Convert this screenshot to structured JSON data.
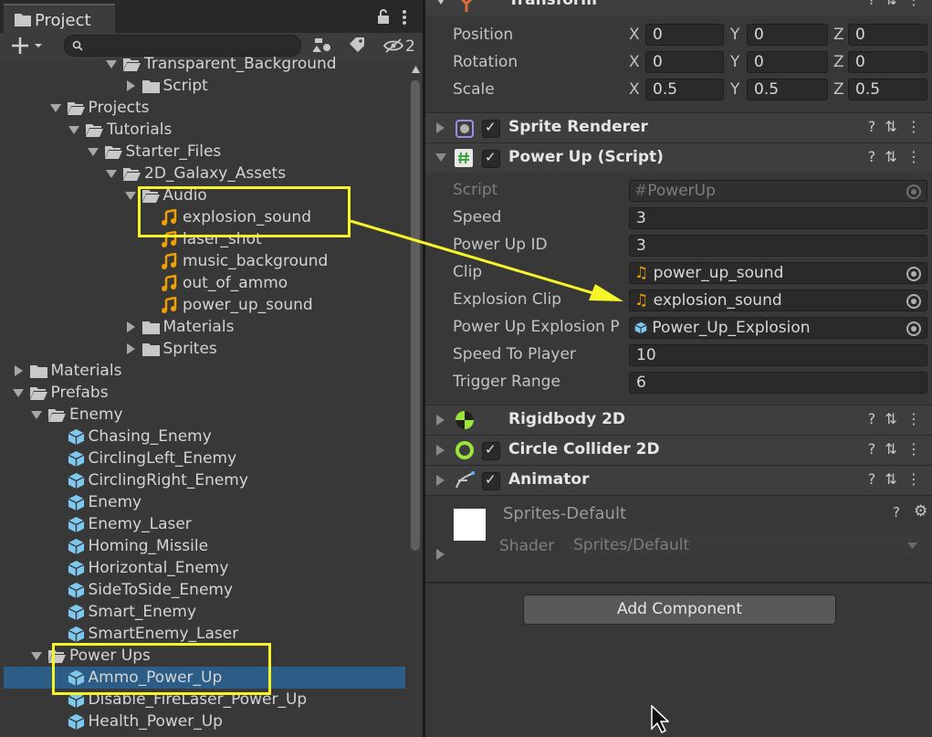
{
  "project_panel": {
    "tab_title": "Project",
    "hidden_count": "2",
    "tree": [
      {
        "label": "Transparent_Background",
        "type": "folder-open",
        "depth": 6
      },
      {
        "label": "Script",
        "type": "folder-closed",
        "depth": 7
      },
      {
        "label": "Projects",
        "type": "folder-open",
        "depth": 3
      },
      {
        "label": "Tutorials",
        "type": "folder-open",
        "depth": 4
      },
      {
        "label": "Starter_Files",
        "type": "folder-open",
        "depth": 5
      },
      {
        "label": "2D_Galaxy_Assets",
        "type": "folder-open",
        "depth": 6
      },
      {
        "label": "Audio",
        "type": "folder-open",
        "depth": 7
      },
      {
        "label": "explosion_sound",
        "type": "audio",
        "depth": 8
      },
      {
        "label": "laser_shot",
        "type": "audio",
        "depth": 8
      },
      {
        "label": "music_background",
        "type": "audio",
        "depth": 8
      },
      {
        "label": "out_of_ammo",
        "type": "audio",
        "depth": 8
      },
      {
        "label": "power_up_sound",
        "type": "audio",
        "depth": 8
      },
      {
        "label": "Materials",
        "type": "folder-closed",
        "depth": 7
      },
      {
        "label": "Sprites",
        "type": "folder-closed",
        "depth": 7
      },
      {
        "label": "Materials",
        "type": "folder-closed",
        "depth": 1
      },
      {
        "label": "Prefabs",
        "type": "folder-open",
        "depth": 1
      },
      {
        "label": "Enemy",
        "type": "folder-open",
        "depth": 2
      },
      {
        "label": "Chasing_Enemy",
        "type": "prefab",
        "depth": 3
      },
      {
        "label": "CirclingLeft_Enemy",
        "type": "prefab",
        "depth": 3
      },
      {
        "label": "CirclingRight_Enemy",
        "type": "prefab",
        "depth": 3
      },
      {
        "label": "Enemy",
        "type": "prefab",
        "depth": 3
      },
      {
        "label": "Enemy_Laser",
        "type": "prefab",
        "depth": 3
      },
      {
        "label": "Homing_Missile",
        "type": "prefab",
        "depth": 3
      },
      {
        "label": "Horizontal_Enemy",
        "type": "prefab",
        "depth": 3
      },
      {
        "label": "SideToSide_Enemy",
        "type": "prefab",
        "depth": 3
      },
      {
        "label": "Smart_Enemy",
        "type": "prefab",
        "depth": 3
      },
      {
        "label": "SmartEnemy_Laser",
        "type": "prefab",
        "depth": 3
      },
      {
        "label": "Power Ups",
        "type": "folder-open",
        "depth": 2
      },
      {
        "label": "Ammo_Power_Up",
        "type": "prefab",
        "depth": 3,
        "selected": true
      },
      {
        "label": "Disable_FireLaser_Power_Up",
        "type": "prefab",
        "depth": 3
      },
      {
        "label": "Health_Power_Up",
        "type": "prefab",
        "depth": 3
      }
    ]
  },
  "inspector": {
    "transform": {
      "title": "Transform",
      "rows": [
        {
          "label": "Position",
          "x": "0",
          "y": "0",
          "z": "0"
        },
        {
          "label": "Rotation",
          "x": "0",
          "y": "0",
          "z": "0"
        },
        {
          "label": "Scale",
          "x": "0.5",
          "y": "0.5",
          "z": "0.5"
        }
      ],
      "axis_x": "X",
      "axis_y": "Y",
      "axis_z": "Z"
    },
    "sprite_renderer": {
      "title": "Sprite Renderer"
    },
    "power_up_script": {
      "title": "Power Up (Script)",
      "script_label": "Script",
      "script_value": "PowerUp",
      "speed_label": "Speed",
      "speed_value": "3",
      "id_label": "Power Up ID",
      "id_value": "3",
      "clip_label": "Clip",
      "clip_value": "power_up_sound",
      "explosion_clip_label": "Explosion Clip",
      "explosion_clip_value": "explosion_sound",
      "explosion_prefab_label": "Power Up Explosion P",
      "explosion_prefab_value": "Power_Up_Explosion",
      "speed_to_player_label": "Speed To Player",
      "speed_to_player_value": "10",
      "trigger_label": "Trigger Range",
      "trigger_value": "6"
    },
    "rigidbody": {
      "title": "Rigidbody 2D"
    },
    "collider": {
      "title": "Circle Collider 2D"
    },
    "animator": {
      "title": "Animator"
    },
    "material": {
      "title": "Sprites-Default",
      "shader_label": "Shader",
      "shader_value": "Sprites/Default"
    },
    "add_component": "Add Component"
  },
  "colors": {
    "highlight": "#f5f52a",
    "selection": "#2c5d87",
    "audio_icon": "#f0a000",
    "prefab_icon": "#7ec8f0"
  }
}
